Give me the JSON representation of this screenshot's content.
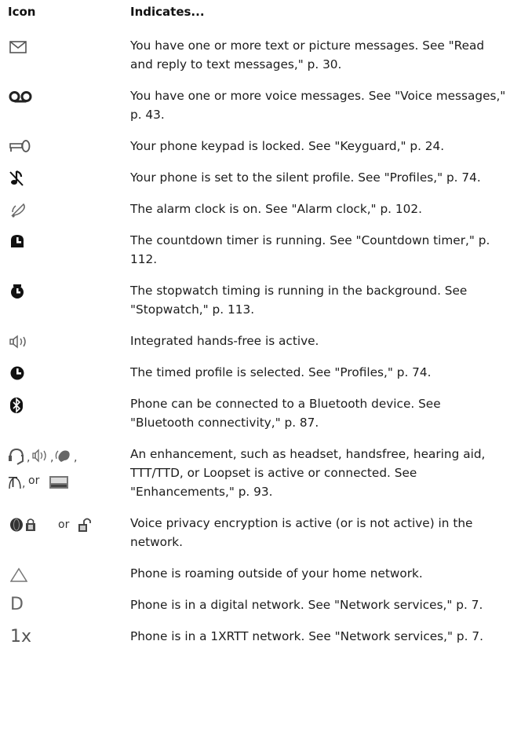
{
  "header": {
    "icon": "Icon",
    "indicates": "Indicates..."
  },
  "rows": [
    {
      "icon": "envelope-icon",
      "text": "You have one or more text or picture messages. See \"Read and reply to text messages,\" p. 30."
    },
    {
      "icon": "voicemail-icon",
      "text": "You have one or more voice messages. See \"Voice messages,\" p. 43."
    },
    {
      "icon": "key-icon",
      "text": "Your phone keypad is locked. See \"Keyguard,\" p. 24."
    },
    {
      "icon": "silent-note-icon",
      "text": "Your phone is set to the silent profile. See \"Profiles,\" p. 74."
    },
    {
      "icon": "alarm-bell-icon",
      "text": "The alarm clock is on. See \"Alarm clock,\" p. 102."
    },
    {
      "icon": "countdown-timer-icon",
      "text": "The countdown timer is running. See \"Countdown timer,\" p. 112."
    },
    {
      "icon": "stopwatch-icon",
      "text": "The stopwatch timing is running in the background. See \"Stopwatch,\" p. 113."
    },
    {
      "icon": "loudspeaker-icon",
      "text": "Integrated hands-free is active."
    },
    {
      "icon": "clock-icon",
      "text": "The timed profile is selected. See \"Profiles,\" p. 74."
    },
    {
      "icon": "bluetooth-icon",
      "text": "Phone can be connected to a Bluetooth device. See \"Bluetooth connectivity,\" p. 87."
    },
    {
      "icon": "enhancements-icons",
      "text": "An enhancement, such as headset, handsfree, hearing aid, TTT/TTD, or Loopset is active or connected. See \"Enhancements,\" p. 93."
    },
    {
      "icon": "privacy-lock-icons",
      "text": "Voice privacy encryption is active (or is not active) in the network."
    },
    {
      "icon": "roaming-triangle-icon",
      "text": "Phone is roaming outside of your home network."
    },
    {
      "icon": "digital-network-icon",
      "text": "Phone is in a digital network. See \"Network services,\" p. 7."
    },
    {
      "icon": "1xrtt-icon",
      "text": "Phone is in a 1XRTT network. See \"Network services,\" p. 7."
    }
  ],
  "icon_text": {
    "or1": "or",
    "or2": "or",
    "digital": "D",
    "onex": "1x"
  }
}
